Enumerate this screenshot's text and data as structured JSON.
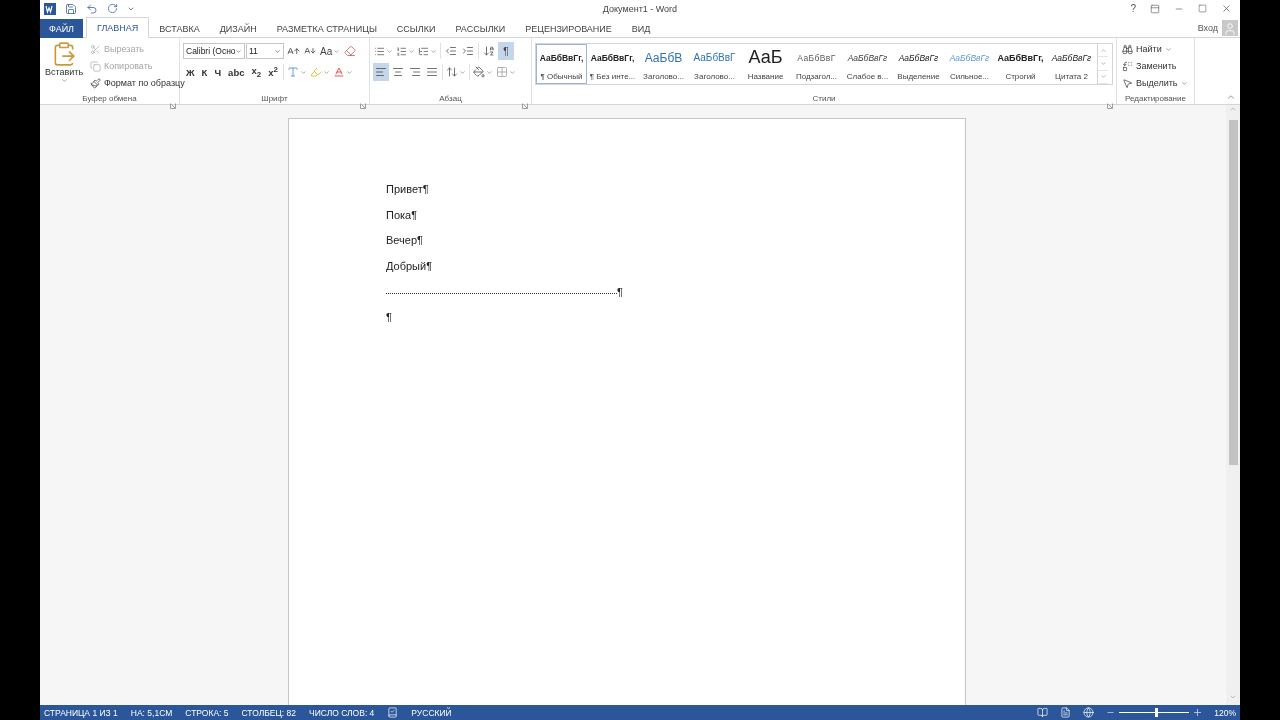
{
  "window": {
    "title": "Документ1 - Word",
    "help": "?",
    "sign_in": "Вход"
  },
  "tabs": [
    {
      "label": "ФАЙЛ",
      "kind": "file",
      "selected": false
    },
    {
      "label": "ГЛАВНАЯ",
      "kind": "tab",
      "selected": true
    },
    {
      "label": "ВСТАВКА",
      "kind": "tab",
      "selected": false
    },
    {
      "label": "ДИЗАЙН",
      "kind": "tab",
      "selected": false
    },
    {
      "label": "РАЗМЕТКА СТРАНИЦЫ",
      "kind": "tab",
      "selected": false
    },
    {
      "label": "ССЫЛКИ",
      "kind": "tab",
      "selected": false
    },
    {
      "label": "РАССЫЛКИ",
      "kind": "tab",
      "selected": false
    },
    {
      "label": "РЕЦЕНЗИРОВАНИЕ",
      "kind": "tab",
      "selected": false
    },
    {
      "label": "ВИД",
      "kind": "tab",
      "selected": false
    }
  ],
  "clipboard": {
    "label": "Буфер обмена",
    "paste": "Вставить",
    "actions": [
      {
        "kind": "cut",
        "label": "Вырезать",
        "disabled": true
      },
      {
        "kind": "copy",
        "label": "Копировать",
        "disabled": true
      },
      {
        "kind": "painter",
        "label": "Формат по образцу",
        "disabled": false
      }
    ]
  },
  "font": {
    "label": "Шрифт",
    "name": "Calibri (Осно",
    "size": "11",
    "case": "Aa",
    "styles": [
      "Ж",
      "К",
      "Ч",
      "abc",
      "x$_{2}$",
      "x$^{2}$"
    ]
  },
  "paragraph": {
    "label": "Абзац",
    "marks": {
      "label": "¶",
      "selected": true
    },
    "alignment": [
      {
        "kind": "left",
        "selected": true
      },
      {
        "kind": "center",
        "selected": false
      },
      {
        "kind": "right",
        "selected": false
      },
      {
        "kind": "justify",
        "selected": false
      }
    ]
  },
  "styles": {
    "label": "Стили",
    "items": [
      {
        "kind": "normal",
        "sample": "АаБбВвГг,",
        "name": "¶ Обычный",
        "selected": true
      },
      {
        "kind": "normal",
        "sample": "АаБбВвГг,",
        "name": "¶ Без инте...",
        "selected": false
      },
      {
        "kind": "heading1",
        "sample": "АаБбВ",
        "name": "Заголово...",
        "selected": false
      },
      {
        "kind": "heading2",
        "sample": "АаБбВвГ",
        "name": "Заголово...",
        "selected": false
      },
      {
        "kind": "title",
        "sample": "АаБ",
        "name": "Название",
        "selected": false
      },
      {
        "kind": "subtitle",
        "sample": "АаБбВвГ",
        "name": "Подзагол...",
        "selected": false
      },
      {
        "kind": "subtle",
        "sample": "АаБбВвГг",
        "name": "Слабое в...",
        "selected": false
      },
      {
        "kind": "emphasis",
        "sample": "АаБбВвГг",
        "name": "Выделение",
        "selected": false
      },
      {
        "kind": "intense",
        "sample": "АаБбВвГг",
        "name": "Сильное...",
        "selected": false
      },
      {
        "kind": "strong",
        "sample": "АаБбВвГг,",
        "name": "Строгий",
        "selected": false
      },
      {
        "kind": "emphasis",
        "sample": "АаБбВвГг",
        "name": "Цитата 2",
        "selected": false
      }
    ]
  },
  "editing": {
    "label": "Редактирование",
    "actions": [
      {
        "kind": "find",
        "label": "Найти"
      },
      {
        "kind": "replace",
        "label": "Заменить"
      },
      {
        "kind": "select",
        "label": "Выделить"
      }
    ]
  },
  "document": {
    "paragraphs": [
      {
        "kind": "text",
        "text": "Привет¶"
      },
      {
        "kind": "text",
        "text": "Пока¶"
      },
      {
        "kind": "text",
        "text": "Вечер¶"
      },
      {
        "kind": "text",
        "text": "Добрый¶"
      },
      {
        "kind": "leader",
        "text": "¶"
      },
      {
        "kind": "text",
        "text": "¶"
      }
    ]
  },
  "status_bar": {
    "items": [
      "СТРАНИЦА 1 ИЗ 1",
      "НА: 5,1СМ",
      "СТРОКА: 5",
      "СТОЛБЕЦ: 82",
      "ЧИСЛО СЛОВ: 4"
    ],
    "language": "РУССКИЙ",
    "zoom": "120%",
    "zoom_slider": {
      "level": 0.53
    }
  }
}
